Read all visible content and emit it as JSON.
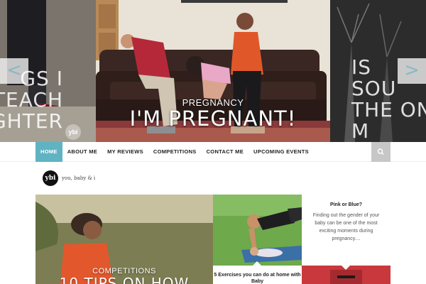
{
  "hero": {
    "left_caption": "GS I\nTEACH\nGHTER",
    "main_category": "PREGNANCY",
    "main_title": "I'M PREGNANT!",
    "right_caption": "IS\nSOU\nTHE ON\nM",
    "prev_symbol": "<",
    "next_symbol": ">",
    "badge": "ybi"
  },
  "nav": {
    "items": [
      {
        "label": "HOME",
        "active": true
      },
      {
        "label": "ABOUT ME"
      },
      {
        "label": "MY REVIEWS"
      },
      {
        "label": "COMPETITIONS"
      },
      {
        "label": "CONTACT ME"
      },
      {
        "label": "UPCOMING EVENTS"
      }
    ],
    "search_icon": "search-icon",
    "accent_color": "#5fb3c2"
  },
  "logo": {
    "mark": "ybi",
    "tagline": "you, baby & i"
  },
  "featured": {
    "big": {
      "category": "COMPETITIONS",
      "title": "10 TIPS ON HOW"
    },
    "exercise": {
      "title": "5 Exercises you can do at home with Baby"
    },
    "pink": {
      "title": "Pink or Blue?",
      "excerpt": "Finding out the gender of your baby can be one of the most exciting moments during pregnancy...."
    }
  }
}
